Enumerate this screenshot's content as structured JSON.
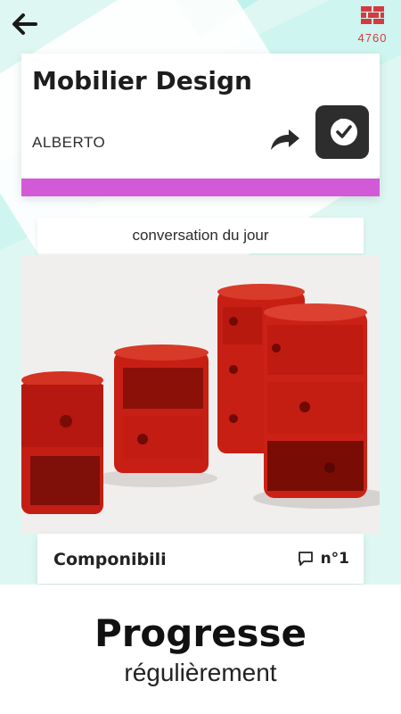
{
  "topbar": {
    "back_icon": "arrow-left-icon",
    "coins": {
      "icon": "bricks-icon",
      "count": "4760",
      "color": "#d43b3f"
    }
  },
  "topcard": {
    "title": "Mobilier Design",
    "author": "ALBERTO",
    "share_icon": "share-arrow-icon",
    "badge_icon": "check-badge-icon",
    "accent_color": "#d35ad6"
  },
  "conversation": {
    "label": "conversation du jour"
  },
  "photo": {
    "alt": "Componibili"
  },
  "caption": {
    "name": "Componibili",
    "comment_icon": "comment-icon",
    "number": "n°1"
  },
  "footer": {
    "headline": "Progresse",
    "subline": "régulièrement"
  }
}
